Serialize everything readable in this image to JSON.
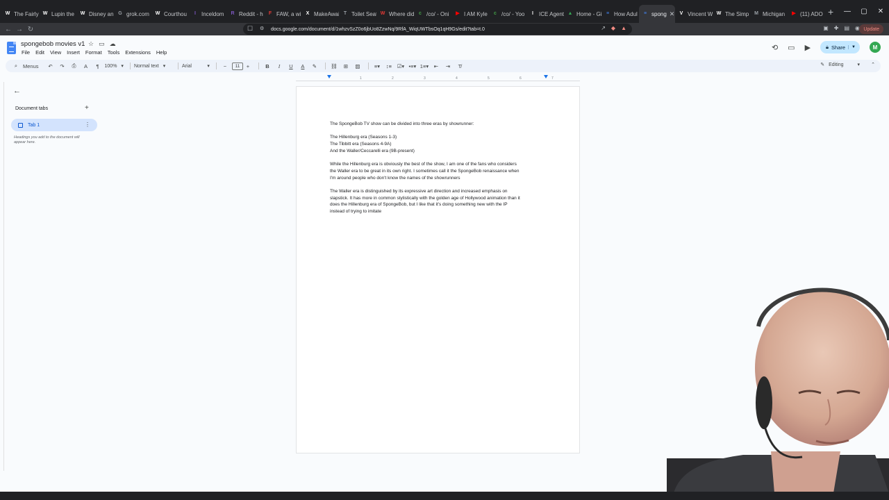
{
  "browser": {
    "tabs": [
      {
        "label": "The Fairly",
        "icon": "wikipedia-icon",
        "color": "#ffffff",
        "glyph": "W"
      },
      {
        "label": "Lupin the",
        "icon": "wikipedia-icon",
        "color": "#ffffff",
        "glyph": "W"
      },
      {
        "label": "Disney an",
        "icon": "wikipedia-icon",
        "color": "#ffffff",
        "glyph": "W"
      },
      {
        "label": "grok.com",
        "icon": "grok-icon",
        "color": "#9aa0a6",
        "glyph": "G"
      },
      {
        "label": "Courthou",
        "icon": "wikipedia-icon",
        "color": "#ffffff",
        "glyph": "W"
      },
      {
        "label": "Inceldom",
        "icon": "site-icon",
        "color": "#7e57c2",
        "glyph": "I"
      },
      {
        "label": "Reddit - h",
        "icon": "site-icon",
        "color": "#7e57c2",
        "glyph": "R"
      },
      {
        "label": "FAW, a wi",
        "icon": "site-icon",
        "color": "#e53935",
        "glyph": "F"
      },
      {
        "label": "MakeAwai",
        "icon": "x-icon",
        "color": "#ffffff",
        "glyph": "X"
      },
      {
        "label": "Toilet Seat",
        "icon": "site-icon",
        "color": "#9aa0a6",
        "glyph": "T"
      },
      {
        "label": "Where did",
        "icon": "site-icon",
        "color": "#e53935",
        "glyph": "W"
      },
      {
        "label": "/co/ - Oni",
        "icon": "site-icon",
        "color": "#43a047",
        "glyph": "c"
      },
      {
        "label": "I AM Kyle",
        "icon": "youtube-icon",
        "color": "#ff0000",
        "glyph": "▶"
      },
      {
        "label": "/co/ - Yoo",
        "icon": "site-icon",
        "color": "#43a047",
        "glyph": "c"
      },
      {
        "label": "ICE Agents",
        "icon": "site-icon",
        "color": "#ffffff",
        "glyph": "I"
      },
      {
        "label": "Home - Gi",
        "icon": "drive-icon",
        "color": "#34a853",
        "glyph": "▲"
      },
      {
        "label": "How Adul",
        "icon": "docs-icon",
        "color": "#4285f4",
        "glyph": "≡"
      },
      {
        "label": "spong",
        "icon": "docs-icon",
        "color": "#4285f4",
        "glyph": "≡",
        "active": true
      },
      {
        "label": "Vincent W",
        "icon": "site-icon",
        "color": "#ffffff",
        "glyph": "V"
      },
      {
        "label": "The Simp",
        "icon": "wikipedia-icon",
        "color": "#ffffff",
        "glyph": "W"
      },
      {
        "label": "Michigan",
        "icon": "site-icon",
        "color": "#9aa0a6",
        "glyph": "M"
      },
      {
        "label": "(11) ADO",
        "icon": "youtube-icon",
        "color": "#ff0000",
        "glyph": "▶"
      }
    ],
    "url": "docs.google.com/document/d/1whzvSzZ0o6jbUo8ZzwNq/9RfA_WiqUWTbsOq1qH9Gs/edit?tab=t.0",
    "update_label": "Update"
  },
  "docs": {
    "title": "spongebob movies v1",
    "menu": [
      "File",
      "Edit",
      "View",
      "Insert",
      "Format",
      "Tools",
      "Extensions",
      "Help"
    ],
    "share_label": "Share",
    "avatar_letter": "M",
    "toolbar": {
      "menus_label": "Menus",
      "zoom": "100%",
      "style": "Normal text",
      "font": "Arial",
      "font_size": "11",
      "mode": "Editing"
    },
    "ruler_ticks": [
      "1",
      "2",
      "3",
      "4",
      "5",
      "6",
      "7"
    ],
    "sidebar": {
      "heading": "Document tabs",
      "tab_label": "Tab 1",
      "hint": "Headings you add to the document will appear here."
    },
    "body": {
      "line1": "The SpongeBob TV show can be divided into three eras by showrunner:",
      "era1": "The Hillenburg era (Seasons 1-3)",
      "era2": "The Tibbitt era (Seasons 4-9A)",
      "era3": "And the Waller/Ceccarelli era (9B-present)",
      "para2_l1": "While the Hillenburg era is obviously the best of the show, I am one of the fans who considers",
      "para2_l2": "the Waller era to be great in its own right. I sometimes call it the SpongeBob renaissance when",
      "para2_l3": "I'm around people who don't know the names of the showrunners",
      "para3_l1": "The Waller era is distinguished by its expressive art direction and increased emphasis on",
      "para3_l2": "slapstick. It has more in common stylistically with the golden age of Hollywood animation than it",
      "para3_l3": "does the Hillenburg era of SpongeBob, but I like that it's doing something new with the IP",
      "para3_l4": "instead of trying to imitate"
    }
  }
}
